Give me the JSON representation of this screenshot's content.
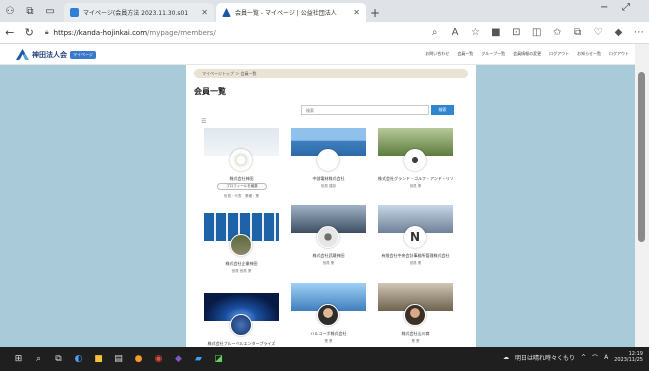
{
  "browser": {
    "tabs": [
      {
        "title": "マイページ(会員方法 2023.11.30.s01",
        "active": false,
        "favicon_color": "#2f7fd6"
      },
      {
        "title": "会員一覧 - マイページ | 公益社団法人",
        "active": true,
        "favicon_color": "#1a57a6"
      }
    ],
    "new_tab": "+",
    "url_domain": "https://kanda-hojinkai.com",
    "url_path": "/mypage/members/",
    "window_min": "−",
    "window_close": "⤢"
  },
  "site": {
    "logo_name": "神田法人会",
    "logo_tag": "マイページ",
    "nav": [
      "お問い合わせ",
      "会員一覧",
      "グループ一覧",
      "会員情報の変更",
      "ログアウト",
      "お知らせ一覧",
      "ログアウト"
    ]
  },
  "page": {
    "breadcrumb": "マイページトップ ＞ 会員一覧",
    "title": "会員一覧",
    "search_placeholder": "検索",
    "search_button": "検索"
  },
  "members": [
    {
      "name": "株式会社神田",
      "meta": "役員・代表　業種・業",
      "profile_button": "プロフィールを編集",
      "banner": "#e9eef3",
      "avatar": "#f3f3f3"
    },
    {
      "name": "中部電材株式会社",
      "meta": "役員 建設",
      "banner": "#3e7fc0",
      "avatar": "#ffffff"
    },
    {
      "name": "株式会社グランド・ゴルフ・アンド・リゾート",
      "meta": "役員 業",
      "banner": "#6c8c45",
      "avatar": "#ffffff"
    },
    {
      "name": "株式会社企業神田",
      "meta": "役員 役員 業",
      "banner": "#1e63a8",
      "avatar": "#6d6a5e"
    },
    {
      "name": "株式会社武蔵神田",
      "meta": "役員 業",
      "banner": "#5a6e84",
      "avatar": "#bfc4c8"
    },
    {
      "name": "有限会社中央会計事務所管理株式会社",
      "meta": "役員 業",
      "banner": "#7a8ea5",
      "avatar": "#ffffff"
    },
    {
      "name": "株式会社ブルーベルエンタープライズ",
      "meta": "",
      "banner": "#0b2a66",
      "avatar": "#1d3f7a"
    },
    {
      "name": "ハルコーポ株式会社",
      "meta": "業 業",
      "banner": "#4f8fcf",
      "avatar": "#b98560"
    },
    {
      "name": "株式会社山川商",
      "meta": "業 業",
      "banner": "#8a7d6a",
      "avatar": "#7e6450"
    }
  ],
  "taskbar": {
    "weather": "明日は晴れ時々くもり",
    "tray_text": "A",
    "time": "12:19",
    "date": "2023/11/25"
  }
}
